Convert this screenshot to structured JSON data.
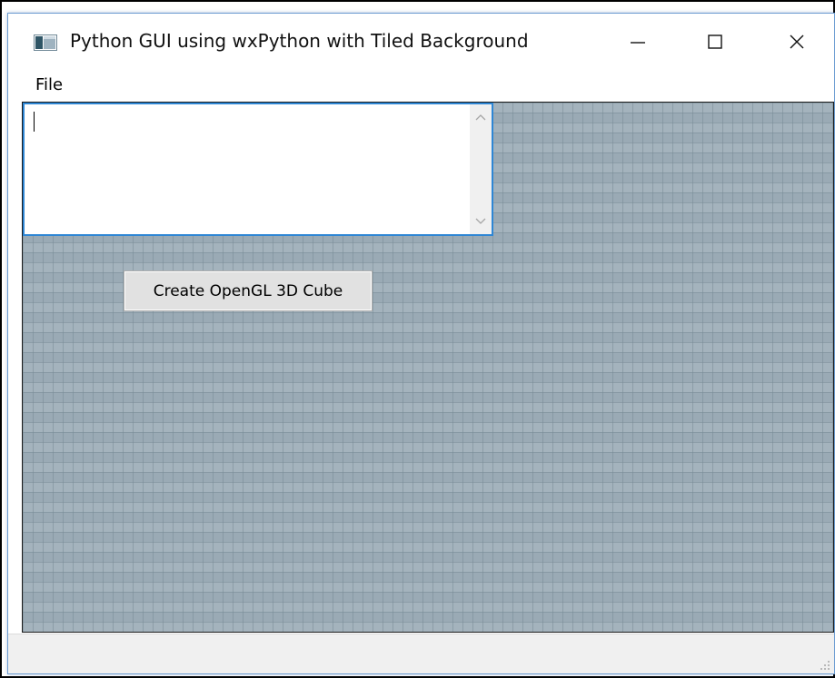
{
  "window": {
    "title": "Python GUI using wxPython with Tiled Background",
    "controls": {
      "minimize_icon": "minimize-icon",
      "maximize_icon": "maximize-icon",
      "close_icon": "close-icon"
    }
  },
  "menu": {
    "items": [
      {
        "label": "File"
      }
    ]
  },
  "main": {
    "text_area": {
      "value": "",
      "placeholder": ""
    },
    "create_button": {
      "label": "Create OpenGL 3D Cube"
    },
    "background": "tiled-grid"
  },
  "colors": {
    "accent_border": "#2e86d4",
    "tile_base": "#9aaab5",
    "status_bar": "#f0f0f0"
  }
}
